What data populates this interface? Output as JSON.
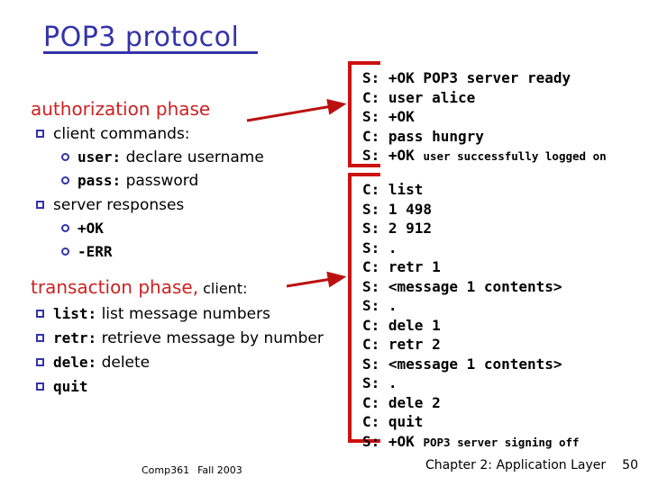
{
  "slide": {
    "title": "POP3 protocol",
    "title_color": "#3333aa",
    "accent_red": "#cc1111",
    "phase_red": "#cc2222"
  },
  "left": {
    "authorization": {
      "heading": "authorization phase",
      "items": [
        {
          "marker": "square",
          "text": "client commands:"
        },
        {
          "marker": "circle",
          "code": "user:",
          "text": " declare username"
        },
        {
          "marker": "circle",
          "code": "pass:",
          "text": " password"
        },
        {
          "marker": "square",
          "text": "server responses"
        },
        {
          "marker": "circle",
          "code": "+OK",
          "text": ""
        },
        {
          "marker": "circle",
          "code": "-ERR",
          "text": ""
        }
      ]
    },
    "transaction": {
      "heading": "transaction phase,",
      "heading_sub": " client:",
      "items": [
        {
          "marker": "square",
          "code": "list:",
          "text": " list message numbers"
        },
        {
          "marker": "square",
          "code": "retr:",
          "text": " retrieve message by number"
        },
        {
          "marker": "square",
          "code": "dele:",
          "text": " delete"
        },
        {
          "marker": "square",
          "code": "quit",
          "text": ""
        }
      ]
    }
  },
  "transcripts": {
    "authorization": {
      "lines": [
        {
          "big": "S: +OK POP3 server ready",
          "small": ""
        },
        {
          "big": "C: user alice",
          "small": ""
        },
        {
          "big": "S: +OK",
          "small": ""
        },
        {
          "big": "C: pass hungry",
          "small": ""
        },
        {
          "big": "S: +OK ",
          "small": "user successfully logged on"
        }
      ]
    },
    "transaction": {
      "lines": [
        {
          "big": "C: list",
          "small": ""
        },
        {
          "big": "S: 1 498",
          "small": ""
        },
        {
          "big": "S: 2 912",
          "small": ""
        },
        {
          "big": "S: .",
          "small": ""
        },
        {
          "big": "C: retr 1",
          "small": ""
        },
        {
          "big": "S: <message 1 contents>",
          "small": ""
        },
        {
          "big": "S: .",
          "small": ""
        },
        {
          "big": "C: dele 1",
          "small": ""
        },
        {
          "big": "C: retr 2",
          "small": ""
        },
        {
          "big": "S: <message 1 contents>",
          "small": ""
        },
        {
          "big": "S: .",
          "small": ""
        },
        {
          "big": "C: dele 2",
          "small": ""
        },
        {
          "big": "C: quit",
          "small": ""
        },
        {
          "big": "S: +OK ",
          "small": "POP3 server signing off"
        }
      ]
    }
  },
  "footer": {
    "course": "Comp361",
    "term": "Fall 2003",
    "chapter": "Chapter 2: Application Layer",
    "page": "50"
  }
}
